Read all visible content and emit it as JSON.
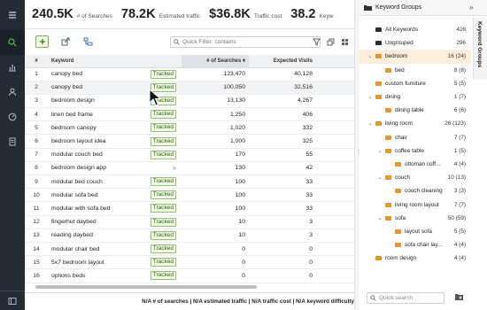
{
  "stats": [
    {
      "value": "240.5K",
      "label": "# of Searches"
    },
    {
      "value": "78.2K",
      "label": "Estimated traffic"
    },
    {
      "value": "$36.8K",
      "label": "Traffic cost"
    },
    {
      "value": "38.2",
      "label": "Keyw"
    }
  ],
  "toolbar": {
    "filter_placeholder": "Quick Filter: contains"
  },
  "table": {
    "columns": [
      "#",
      "Keyword",
      "# of Searches",
      "Expected Visits",
      "Co"
    ],
    "sorted_column": "# of Searches",
    "rows": [
      {
        "idx": "1",
        "keyword": "canopy bed",
        "tag": "Tracked",
        "searches": "123,470",
        "visits": "40,128"
      },
      {
        "idx": "2",
        "keyword": "canopy bed",
        "tag": "Tracked",
        "searches": "100,050",
        "visits": "32,516"
      },
      {
        "idx": "3",
        "keyword": "bedroom design",
        "tag": "Tracked",
        "searches": "13,130",
        "visits": "4,267"
      },
      {
        "idx": "4",
        "keyword": "linen bed frame",
        "tag": "Tracked",
        "searches": "1,250",
        "visits": "406"
      },
      {
        "idx": "5",
        "keyword": "bedroom canopy",
        "tag": "Tracked",
        "searches": "1,020",
        "visits": "332"
      },
      {
        "idx": "6",
        "keyword": "bedroom layout idea",
        "tag": "Tracked",
        "searches": "1,000",
        "visits": "325"
      },
      {
        "idx": "7",
        "keyword": "modular couch bed",
        "tag": "Tracked",
        "searches": "170",
        "visits": "55"
      },
      {
        "idx": "8",
        "keyword": "bedroom design app",
        "tag": "»",
        "searches": "130",
        "visits": "42"
      },
      {
        "idx": "9",
        "keyword": "modular bed couch",
        "tag": "Tracked",
        "searches": "100",
        "visits": "33"
      },
      {
        "idx": "10",
        "keyword": "modular sofa bed",
        "tag": "Tracked",
        "searches": "100",
        "visits": "33"
      },
      {
        "idx": "11",
        "keyword": "modular with sofa bed",
        "tag": "Tracked",
        "searches": "100",
        "visits": "33"
      },
      {
        "idx": "12",
        "keyword": "fingerhut daybed",
        "tag": "Tracked",
        "searches": "10",
        "visits": "3"
      },
      {
        "idx": "13",
        "keyword": "reading daybed",
        "tag": "Tracked",
        "searches": "10",
        "visits": "3"
      },
      {
        "idx": "14",
        "keyword": "modular chair bed",
        "tag": "Tracked",
        "searches": "0",
        "visits": "0"
      },
      {
        "idx": "15",
        "keyword": "5x7 bedroom layout",
        "tag": "Tracked",
        "searches": "0",
        "visits": "0"
      },
      {
        "idx": "16",
        "keyword": "options beds",
        "tag": "Tracked",
        "searches": "0",
        "visits": "0"
      }
    ]
  },
  "footer": {
    "text": "N/A # of searches | N/A estimated traffic | N/A traffic cost | N/A keyword difficulty"
  },
  "panel": {
    "title": "Keyword Groups",
    "vertical_tab": "Keyword Groups",
    "search_placeholder": "Quick search",
    "groups": [
      {
        "level": 0,
        "name": "All Keywords",
        "count": "428",
        "folder": "dark",
        "expander": ""
      },
      {
        "level": 0,
        "name": "Ungrouped",
        "count": "296",
        "folder": "dark",
        "expander": ""
      },
      {
        "level": 0,
        "name": "bedroom",
        "count": "16 (24)",
        "folder": "orange",
        "expander": "⌄",
        "highlight": true
      },
      {
        "level": 1,
        "name": "bed",
        "count": "8 (8)",
        "folder": "orange",
        "expander": ""
      },
      {
        "level": 0,
        "name": "custom furniture",
        "count": "5 (5)",
        "folder": "orange",
        "expander": ""
      },
      {
        "level": 0,
        "name": "dining",
        "count": "1 (7)",
        "folder": "orange",
        "expander": "⌄"
      },
      {
        "level": 1,
        "name": "dining table",
        "count": "6 (6)",
        "folder": "orange",
        "expander": ""
      },
      {
        "level": 0,
        "name": "living room",
        "count": "26 (123)",
        "folder": "orange",
        "expander": "⌄"
      },
      {
        "level": 1,
        "name": "chair",
        "count": "7 (7)",
        "folder": "orange",
        "expander": ""
      },
      {
        "level": 1,
        "name": "coffee table",
        "count": "1 (5)",
        "folder": "orange",
        "expander": "⌄"
      },
      {
        "level": 2,
        "name": "ottoman coff...",
        "count": "4 (4)",
        "folder": "orange",
        "expander": ""
      },
      {
        "level": 1,
        "name": "couch",
        "count": "10 (13)",
        "folder": "orange",
        "expander": "⌄"
      },
      {
        "level": 2,
        "name": "couch cleaning",
        "count": "3 (3)",
        "folder": "orange",
        "expander": ""
      },
      {
        "level": 1,
        "name": "living room layout",
        "count": "7 (7)",
        "folder": "orange",
        "expander": ""
      },
      {
        "level": 1,
        "name": "sofa",
        "count": "50 (59)",
        "folder": "orange",
        "expander": "⌄"
      },
      {
        "level": 2,
        "name": "layout sofa",
        "count": "5 (5)",
        "folder": "orange",
        "expander": ""
      },
      {
        "level": 2,
        "name": "sofa chair lay...",
        "count": "4 (4)",
        "folder": "orange",
        "expander": ""
      },
      {
        "level": 0,
        "name": "room design",
        "count": "4 (4)",
        "folder": "orange",
        "expander": ""
      }
    ]
  },
  "colors": {
    "sidebar_bg": "#242b33",
    "accent_green": "#4ec04e",
    "folder_orange": "#e8952b",
    "tag_border": "#8ec46b",
    "highlight_row": "#fbefdc"
  }
}
